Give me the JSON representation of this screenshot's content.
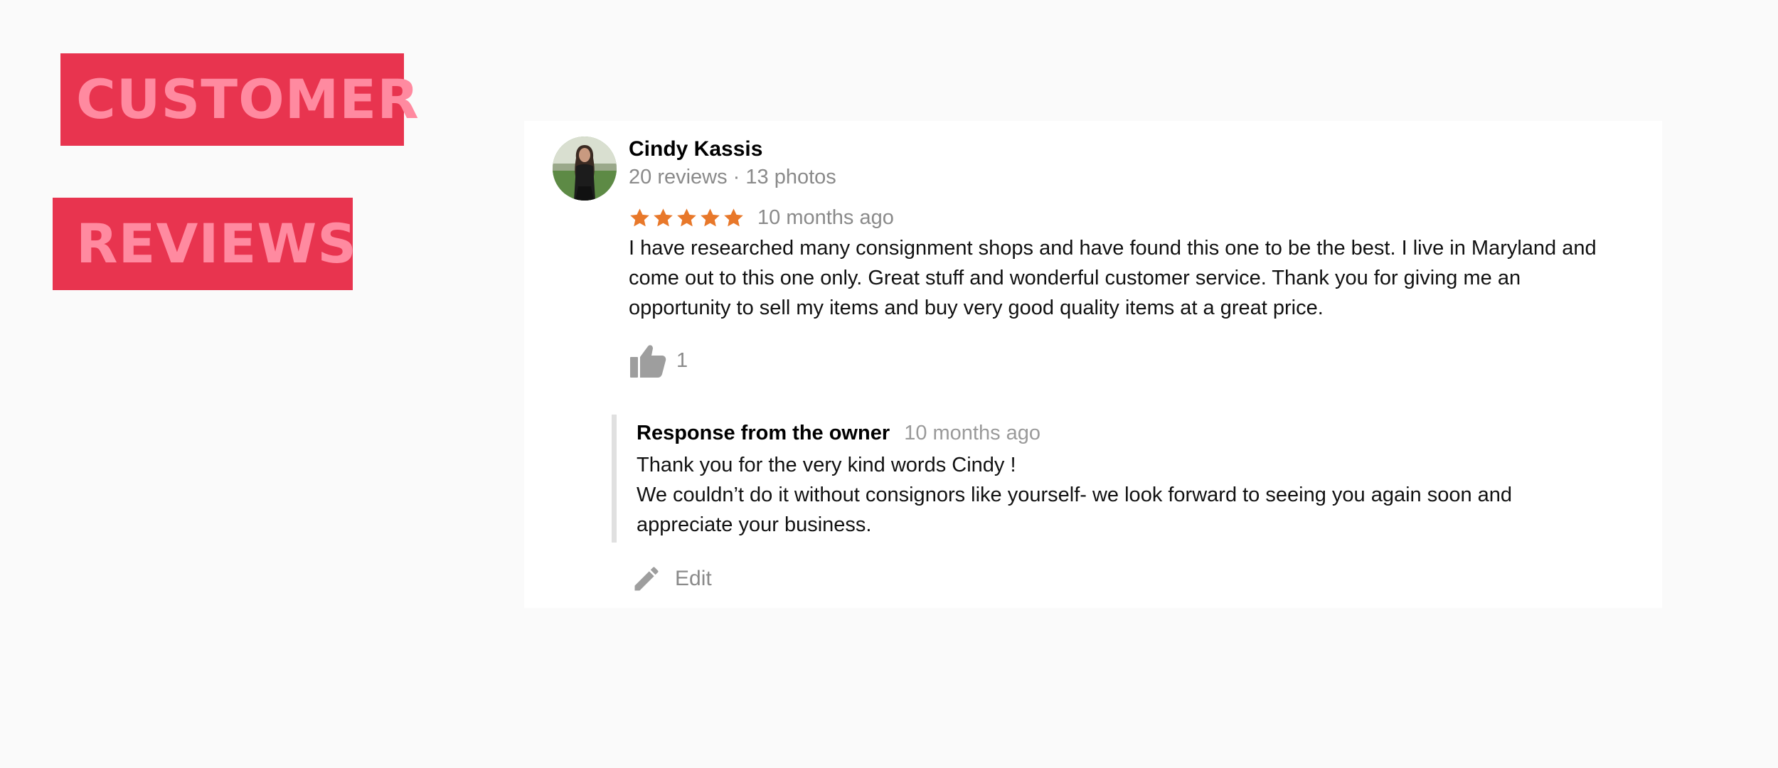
{
  "headings": {
    "line1": "CUSTOMER",
    "line2": "REVIEWS"
  },
  "colors": {
    "badge_bg": "#e8344f",
    "badge_text": "#ff8aa0",
    "star": "#e8782a",
    "muted": "#8a8a8a"
  },
  "review": {
    "author": {
      "name": "Cindy Kassis",
      "meta": "20 reviews · 13 photos",
      "avatar_icon": "user-avatar-photo"
    },
    "rating": 5,
    "rating_max": 5,
    "time": "10 months ago",
    "text": "I have researched many consignment shops and have found this one to be the best.  I live in Maryland and come out to this one only.  Great stuff and wonderful customer service. Thank you for giving me an opportunity to sell my items and buy very good quality items at a great price.",
    "likes": {
      "icon": "thumbs-up-icon",
      "count": "1"
    },
    "owner_response": {
      "title": "Response from the owner",
      "time": "10 months ago",
      "text": "Thank you for the very kind words Cindy !\nWe couldn’t do it without consignors like yourself- we look forward to seeing you again soon and appreciate your business."
    },
    "edit": {
      "icon": "pencil-icon",
      "label": "Edit"
    }
  }
}
